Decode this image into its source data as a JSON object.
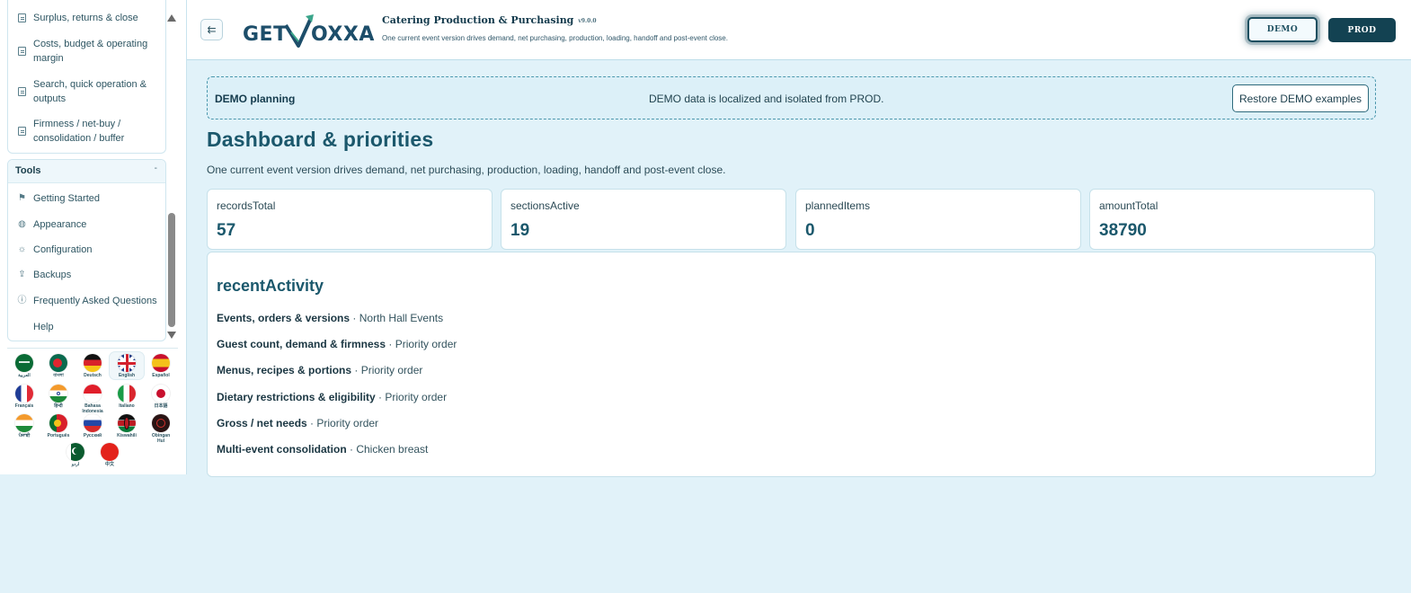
{
  "sidebar": {
    "menu_items": [
      {
        "label": "Surplus, returns & close",
        "icon": "document-icon"
      },
      {
        "label": "Costs, budget & operating margin",
        "icon": "document-icon"
      },
      {
        "label": "Search, quick operation & outputs",
        "icon": "document-icon"
      },
      {
        "label": "Firmness / net-buy / consolidation / buffer",
        "icon": "document-icon"
      }
    ],
    "tools": {
      "title": "Tools",
      "collapse_glyph": "-",
      "items": [
        {
          "label": "Getting Started",
          "icon": "flag-icon"
        },
        {
          "label": "Appearance",
          "icon": "palette-icon"
        },
        {
          "label": "Configuration",
          "icon": "gear-icon"
        },
        {
          "label": "Backups",
          "icon": "upload-icon"
        },
        {
          "label": "Frequently Asked Questions",
          "icon": "question-icon"
        },
        {
          "label": "Help",
          "icon": ""
        }
      ]
    },
    "languages": [
      {
        "name": "العربية"
      },
      {
        "name": "বাংলা"
      },
      {
        "name": "Deutsch"
      },
      {
        "name": "English",
        "selected": true
      },
      {
        "name": "Español"
      },
      {
        "name": "Français"
      },
      {
        "name": "हिन्दी"
      },
      {
        "name": "Bahasa Indonesia"
      },
      {
        "name": "Italiano"
      },
      {
        "name": "日本語"
      },
      {
        "name": "ਪੰਜਾਬੀ"
      },
      {
        "name": "Português"
      },
      {
        "name": "Русский"
      },
      {
        "name": "Kiswahili"
      },
      {
        "name": "Obingan Hul"
      },
      {
        "name": "اردو"
      },
      {
        "name": "中文"
      }
    ]
  },
  "header": {
    "collapse_glyph": "⇇",
    "logo_text_left": "GET",
    "logo_text_right": "OXXA",
    "title": "Catering Production & Purchasing",
    "version": "v9.0.0",
    "subtitle": "One current event version drives demand, net purchasing, production, loading, handoff and post-event close.",
    "demo_label": "DEMO",
    "prod_label": "PROD"
  },
  "banner": {
    "title": "DEMO planning",
    "message": "DEMO data is localized and isolated from PROD.",
    "button": "Restore DEMO examples"
  },
  "main": {
    "title": "Dashboard & priorities",
    "subtitle": "One current event version drives demand, net purchasing, production, loading, handoff and post-event close.",
    "stats": [
      {
        "key": "recordsTotal",
        "value": "57"
      },
      {
        "key": "sectionsActive",
        "value": "19"
      },
      {
        "key": "plannedItems",
        "value": "0"
      },
      {
        "key": "amountTotal",
        "value": "38790"
      }
    ],
    "activity": {
      "title": "recentActivity",
      "rows": [
        {
          "label": "Events, orders & versions",
          "detail": " · North Hall Events"
        },
        {
          "label": "Guest count, demand & firmness",
          "detail": " · Priority order"
        },
        {
          "label": "Menus, recipes & portions",
          "detail": " · Priority order"
        },
        {
          "label": "Dietary restrictions & eligibility",
          "detail": " · Priority order"
        },
        {
          "label": "Gross / net needs",
          "detail": " · Priority order"
        },
        {
          "label": "Multi-event consolidation",
          "detail": " · Chicken breast"
        }
      ]
    }
  },
  "colors": {
    "accent": "#1b586c",
    "background": "#e1f2f9",
    "prod_button": "#134252"
  }
}
